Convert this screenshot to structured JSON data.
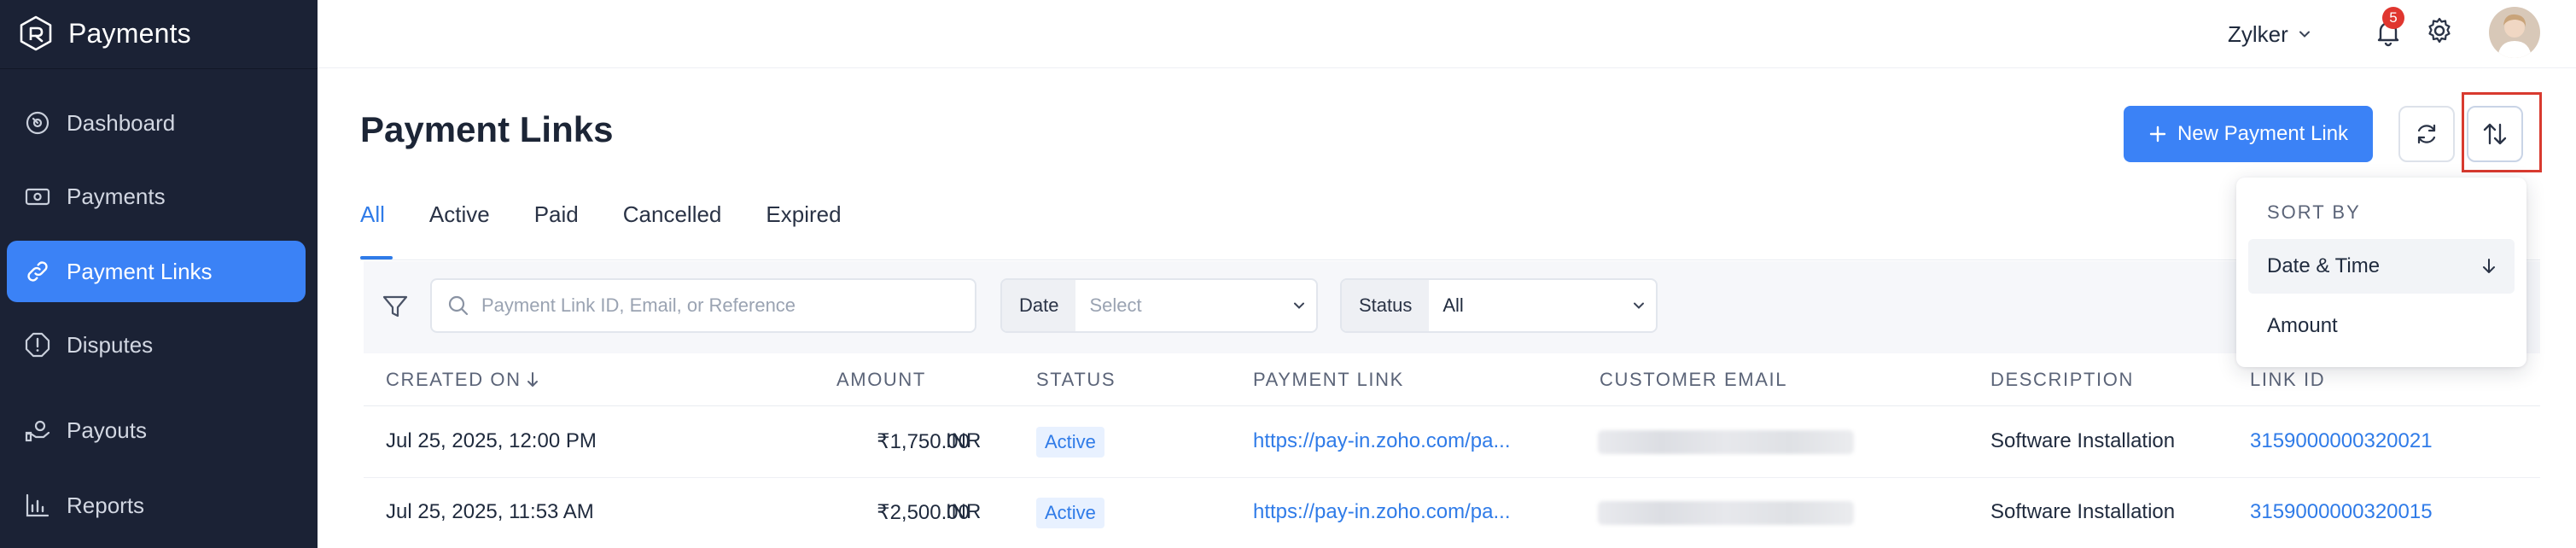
{
  "app": {
    "name": "Payments"
  },
  "sidebar": {
    "items": [
      {
        "label": "Dashboard",
        "icon": "dashboard-icon"
      },
      {
        "label": "Payments",
        "icon": "payments-icon"
      },
      {
        "label": "Payment Links",
        "icon": "link-icon",
        "active": true
      },
      {
        "label": "Disputes",
        "icon": "dispute-icon"
      },
      {
        "label": "Payouts",
        "icon": "payouts-icon"
      },
      {
        "label": "Reports",
        "icon": "reports-icon"
      }
    ]
  },
  "header": {
    "org_name": "Zylker",
    "notification_count": "5"
  },
  "page": {
    "title": "Payment Links",
    "new_button_label": "New Payment Link"
  },
  "tabs": [
    "All",
    "Active",
    "Paid",
    "Cancelled",
    "Expired"
  ],
  "filters": {
    "search_placeholder": "Payment Link ID, Email, or Reference",
    "date_label": "Date",
    "date_value": "Select",
    "status_label": "Status",
    "status_value": "All"
  },
  "table": {
    "headers": {
      "created_on": "CREATED ON",
      "amount": "AMOUNT",
      "status": "STATUS",
      "payment_link": "PAYMENT LINK",
      "customer_email": "CUSTOMER EMAIL",
      "description": "DESCRIPTION",
      "link_id": "LINK ID"
    },
    "rows": [
      {
        "created_on": "Jul 25, 2025, 12:00 PM",
        "amount": "₹1,750.00",
        "currency": "INR",
        "status": "Active",
        "payment_link": "https://pay-in.zoho.com/pa...",
        "description": "Software Installation",
        "link_id": "3159000000320021"
      },
      {
        "created_on": "Jul 25, 2025, 11:53 AM",
        "amount": "₹2,500.00",
        "currency": "INR",
        "status": "Active",
        "payment_link": "https://pay-in.zoho.com/pa...",
        "description": "Software Installation",
        "link_id": "3159000000320015"
      }
    ]
  },
  "sort_dropdown": {
    "title": "SORT BY",
    "options": [
      {
        "label": "Date & Time",
        "selected": true
      },
      {
        "label": "Amount"
      }
    ]
  },
  "colors": {
    "accent": "#3b82f6",
    "sidebar_bg": "#1b2235",
    "highlight": "#d83a2f",
    "badge": "#e0362f"
  }
}
